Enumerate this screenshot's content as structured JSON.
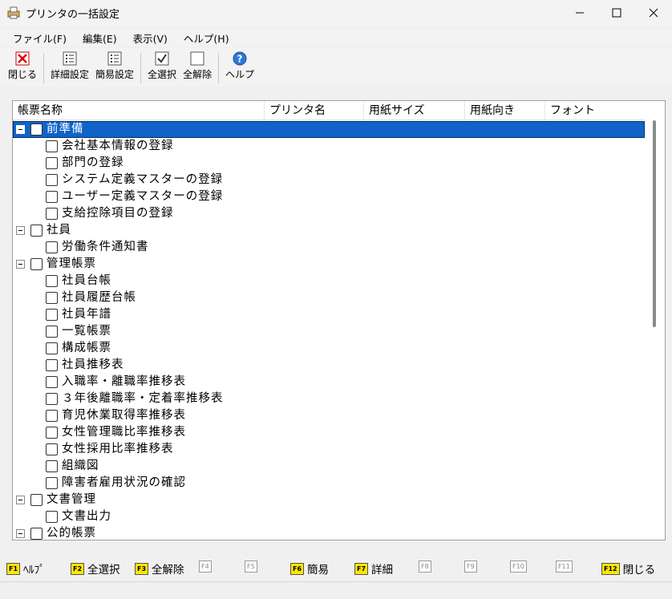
{
  "window": {
    "title": "プリンタの一括設定"
  },
  "menu": [
    "ファイル(F)",
    "編集(E)",
    "表示(V)",
    "ヘルプ(H)"
  ],
  "toolbar": {
    "close": "閉じる",
    "detail": "詳細設定",
    "simple": "簡易設定",
    "select_all": "全選択",
    "deselect_all": "全解除",
    "help": "ヘルプ"
  },
  "columns": [
    "帳票名称",
    "プリンタ名",
    "用紙サイズ",
    "用紙向き",
    "フォント"
  ],
  "rows": [
    {
      "label": "前準備",
      "group": true,
      "selected": true
    },
    {
      "label": "会社基本情報の登録"
    },
    {
      "label": "部門の登録"
    },
    {
      "label": "システム定義マスターの登録"
    },
    {
      "label": "ユーザー定義マスターの登録"
    },
    {
      "label": "支給控除項目の登録"
    },
    {
      "label": "社員",
      "group": true
    },
    {
      "label": "労働条件通知書"
    },
    {
      "label": "管理帳票",
      "group": true
    },
    {
      "label": "社員台帳"
    },
    {
      "label": "社員履歴台帳"
    },
    {
      "label": "社員年譜"
    },
    {
      "label": "一覧帳票"
    },
    {
      "label": "構成帳票"
    },
    {
      "label": "社員推移表"
    },
    {
      "label": "入職率・離職率推移表"
    },
    {
      "label": "３年後離職率・定着率推移表"
    },
    {
      "label": "育児休業取得率推移表"
    },
    {
      "label": "女性管理職比率推移表"
    },
    {
      "label": "女性採用比率推移表"
    },
    {
      "label": "組織図"
    },
    {
      "label": "障害者雇用状況の確認"
    },
    {
      "label": "文書管理",
      "group": true
    },
    {
      "label": "文書出力"
    },
    {
      "label": "公的帳票",
      "group": true
    }
  ],
  "fkeys": [
    {
      "key": "F1",
      "label": "ﾍﾙﾌﾟ",
      "on": true
    },
    {
      "key": "F2",
      "label": "全選択",
      "on": true
    },
    {
      "key": "F3",
      "label": "全解除",
      "on": true
    },
    {
      "key": "F4",
      "label": "",
      "on": false
    },
    {
      "key": "F5",
      "label": "",
      "on": false
    },
    {
      "key": "F6",
      "label": "簡易",
      "on": true
    },
    {
      "key": "F7",
      "label": "詳細",
      "on": true
    },
    {
      "key": "F8",
      "label": "",
      "on": false
    },
    {
      "key": "F9",
      "label": "",
      "on": false
    },
    {
      "key": "F10",
      "label": "",
      "on": false
    },
    {
      "key": "F11",
      "label": "",
      "on": false
    },
    {
      "key": "F12",
      "label": "閉じる",
      "on": true
    }
  ],
  "colors": {
    "selection": "#0f63c9",
    "fkey_active": "#ffe600"
  }
}
